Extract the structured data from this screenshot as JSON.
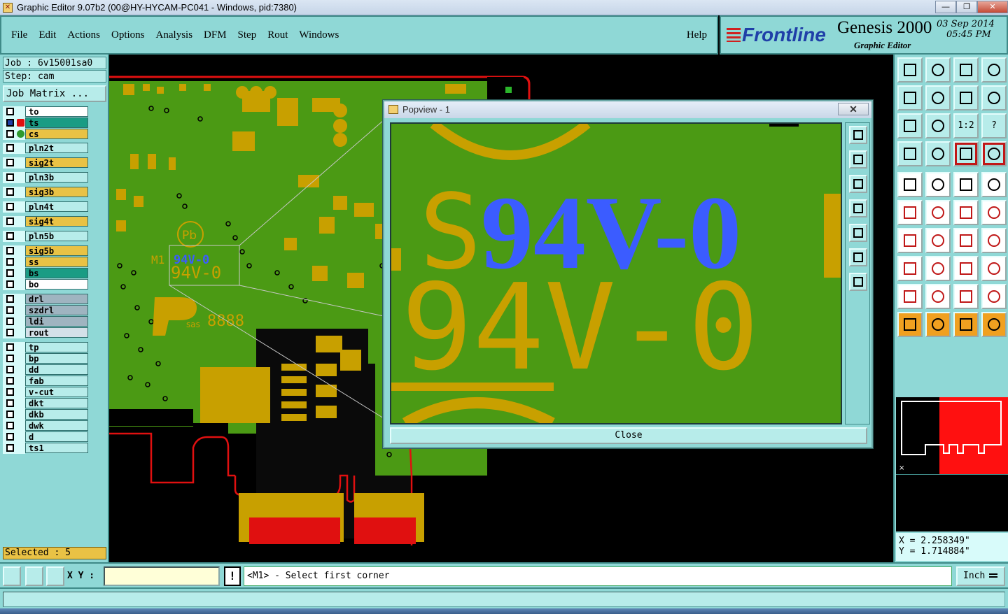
{
  "window": {
    "title": "Graphic Editor 9.07b2 (00@HY-HYCAM-PC041 - Windows, pid:7380)",
    "buttons": [
      "—",
      "❐",
      "✕"
    ]
  },
  "menu": {
    "items": [
      "File",
      "Edit",
      "Actions",
      "Options",
      "Analysis",
      "DFM",
      "Step",
      "Rout",
      "Windows"
    ],
    "help": "Help"
  },
  "branding": {
    "logo": "Frontline",
    "product": "Genesis 2000",
    "module": "Graphic Editor",
    "date": "03  Sep  2014",
    "time": "05:45  PM"
  },
  "left_panel": {
    "job": "Job  :  6v15001sa0",
    "step": "Step:  cam",
    "job_matrix": "Job Matrix ...",
    "selected": "Selected : 5",
    "layers": [
      {
        "name": "to",
        "color": "#ffffff"
      },
      {
        "name": "ts",
        "color": "#1a9c84"
      },
      {
        "name": "cs",
        "color": "#e9c245"
      },
      {
        "name": "pln2t",
        "color": "#b7ecea"
      },
      {
        "name": "sig2t",
        "color": "#e9c245"
      },
      {
        "name": "pln3b",
        "color": "#b7ecea"
      },
      {
        "name": "sig3b",
        "color": "#e9c245"
      },
      {
        "name": "pln4t",
        "color": "#b7ecea"
      },
      {
        "name": "sig4t",
        "color": "#e9c245"
      },
      {
        "name": "pln5b",
        "color": "#b7ecea"
      },
      {
        "name": "sig5b",
        "color": "#e9c245"
      },
      {
        "name": "ss",
        "color": "#e9c245"
      },
      {
        "name": "bs",
        "color": "#1a9c84"
      },
      {
        "name": "bo",
        "color": "#ffffff"
      },
      {
        "name": "drl",
        "color": "#9fb4c0"
      },
      {
        "name": "szdrl",
        "color": "#9fb4c0"
      },
      {
        "name": "ldi",
        "color": "#9fb4c0"
      },
      {
        "name": "rout",
        "color": "#d4e0e8"
      },
      {
        "name": "tp",
        "color": "#b7ecea"
      },
      {
        "name": "bp",
        "color": "#b7ecea"
      },
      {
        "name": "dd",
        "color": "#b7ecea"
      },
      {
        "name": "fab",
        "color": "#b7ecea"
      },
      {
        "name": "v-cut",
        "color": "#b7ecea"
      },
      {
        "name": "dkt",
        "color": "#b7ecea"
      },
      {
        "name": "dkb",
        "color": "#b7ecea"
      },
      {
        "name": "dwk",
        "color": "#b7ecea"
      },
      {
        "name": "d",
        "color": "#b7ecea"
      },
      {
        "name": "ts1",
        "color": "#b7ecea"
      }
    ]
  },
  "board": {
    "silk_text_1": "M1",
    "silk_text_2": "94V-0",
    "silk_text_3": "94V-0",
    "silk_text_4": "sas",
    "silk_text_5": "8888",
    "pb": "Pb"
  },
  "popview": {
    "title": "Popview - 1",
    "close_x": "✕",
    "close_label": "Close",
    "text_partial": "S",
    "text_blue": "94V-0",
    "text_yellow": "94V-0"
  },
  "right_panel": {
    "tools_row3": [
      "",
      "",
      "1:2",
      "?"
    ],
    "coord_x": "X  =  2.258349\"",
    "coord_y": "Y  =  1.714884\""
  },
  "status": {
    "xy_label": "X Y :",
    "xy_value": "",
    "excl": "!",
    "prompt": "<M1> - Select first corner",
    "units": "Inch"
  },
  "colors": {
    "panel": "#8fd8d6",
    "board_green": "#4b9a14",
    "copper_yellow": "#c8a000",
    "highlight_blue": "#3b5cff",
    "outline_red": "#e01010"
  }
}
